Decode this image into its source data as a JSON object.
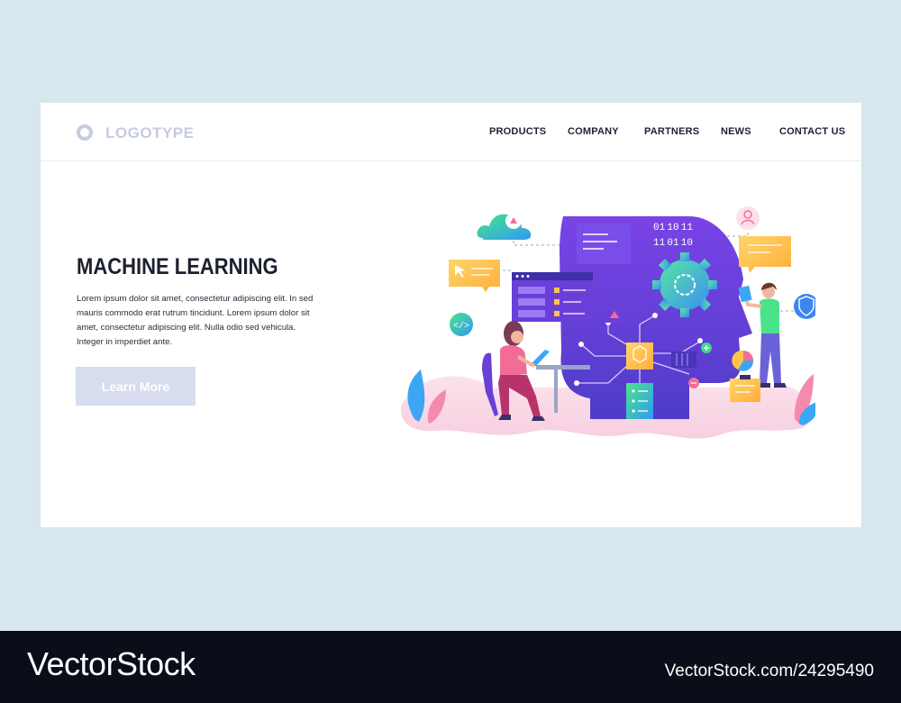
{
  "header": {
    "logo_text": "LOGOTYPE",
    "nav": [
      "PRODUCTS",
      "COMPANY",
      "PARTNERS",
      "NEWS",
      "CONTACT US"
    ]
  },
  "hero": {
    "title": "MACHINE LEARNING",
    "body": "Lorem ipsum dolor sit amet, consectetur adipiscing elit. In sed mauris commodo erat rutrum tincidunt. Lorem ipsum dolor sit amet, consectetur adipiscing elit. Nulla  odio sed vehicula. Integer in imperdiet ante.",
    "button_label": "Learn More",
    "binary_top": "01 10 11",
    "binary_bottom": "11 01 10"
  },
  "footer": {
    "brand": "VectorStock",
    "image_id": "VectorStock.com/24295490"
  },
  "colors": {
    "page_bg": "#d8e6ee",
    "card_bg": "#ffffff",
    "head_purple": "#6a3fd8",
    "head_violet": "#8b4cf0",
    "button_bg": "#d7dcee",
    "footer_bg": "#0b0e19",
    "accent_yellow": "#ffc54a",
    "accent_green": "#47d98a",
    "accent_blue": "#3ca6f5",
    "accent_pink": "#f26d96"
  },
  "icons": [
    "logo-circle-icon",
    "cloud-upload-icon",
    "user-avatar-icon",
    "code-icon",
    "cursor-icon",
    "shield-icon",
    "gear-icon",
    "cube-icon",
    "pie-chart-icon",
    "server-icon",
    "calendar-icon",
    "plus-icon",
    "minus-icon"
  ]
}
